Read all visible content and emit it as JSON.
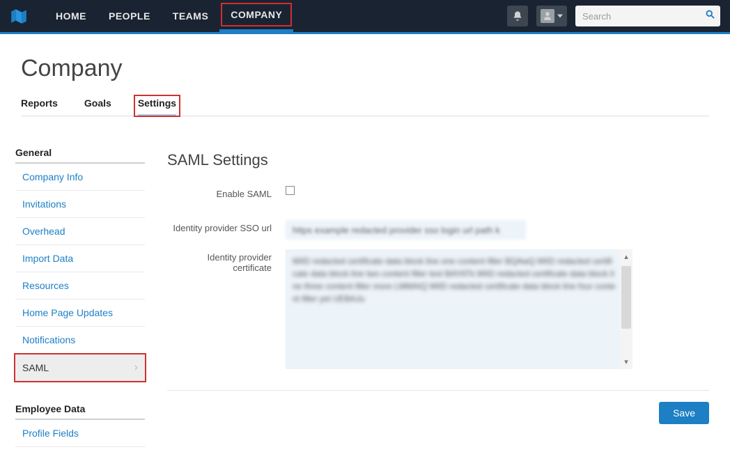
{
  "nav": {
    "items": [
      {
        "label": "HOME"
      },
      {
        "label": "PEOPLE"
      },
      {
        "label": "TEAMS"
      },
      {
        "label": "COMPANY"
      }
    ],
    "search_placeholder": "Search"
  },
  "page": {
    "title": "Company",
    "tabs": [
      {
        "label": "Reports"
      },
      {
        "label": "Goals"
      },
      {
        "label": "Settings"
      }
    ]
  },
  "sidebar": {
    "section1_title": "General",
    "section1_items": [
      {
        "label": "Company Info"
      },
      {
        "label": "Invitations"
      },
      {
        "label": "Overhead"
      },
      {
        "label": "Import Data"
      },
      {
        "label": "Resources"
      },
      {
        "label": "Home Page Updates"
      },
      {
        "label": "Notifications"
      },
      {
        "label": "SAML"
      }
    ],
    "section2_title": "Employee Data",
    "section2_items": [
      {
        "label": "Profile Fields"
      }
    ]
  },
  "main": {
    "title": "SAML Settings",
    "labels": {
      "enable_saml": "Enable SAML",
      "sso_url": "Identity provider SSO url",
      "cert": "Identity provider certificate"
    },
    "values": {
      "sso_url": "https example redacted provider sso login url path k",
      "cert": "MIID redacted certificate data block line one content filler\nBQAwQ\nMIID redacted certificate data block line two content filler text\nBAYATk\nMIID redacted certificate data block line three content filler more\nLMMAIQ\nMIID redacted certificate data block line four content filler yet\nUEBAJu"
    },
    "save_label": "Save"
  }
}
